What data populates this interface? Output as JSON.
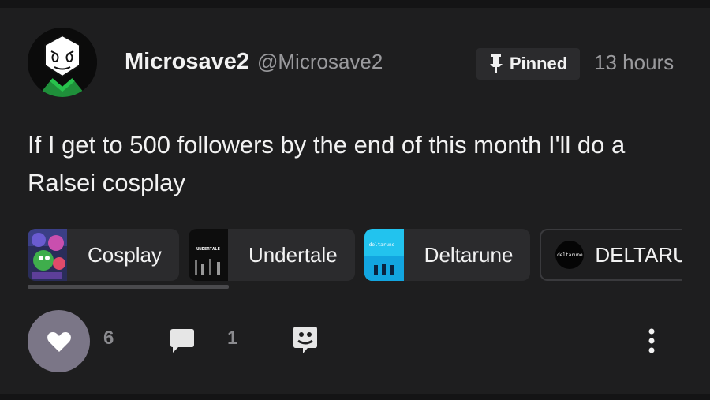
{
  "post": {
    "author_name": "Microsave2",
    "author_handle": "@Microsave2",
    "pinned_label": "Pinned",
    "time": "13 hours",
    "text": "If I get to 500 followers by the end of this month I'll do a Ralsei cosplay"
  },
  "tags": [
    {
      "label": "Cosplay"
    },
    {
      "label": "Undertale",
      "thumb_text": "UNDERTALE"
    },
    {
      "label": "Deltarune",
      "thumb_text": "deltarune"
    },
    {
      "label": "DELTARUNE",
      "thumb_text": "deltarune"
    }
  ],
  "actions": {
    "like_count": "6",
    "comment_count": "1"
  },
  "icons": {
    "pin": "pin-icon",
    "like": "heart-icon",
    "comment": "comment-icon",
    "reblog": "reblog-icon",
    "more": "more-vertical-icon"
  },
  "colors": {
    "background": "#1e1e1f",
    "chip": "#2b2b2d",
    "like_button": "#7b7687",
    "muted_text": "#9a9a9d"
  }
}
